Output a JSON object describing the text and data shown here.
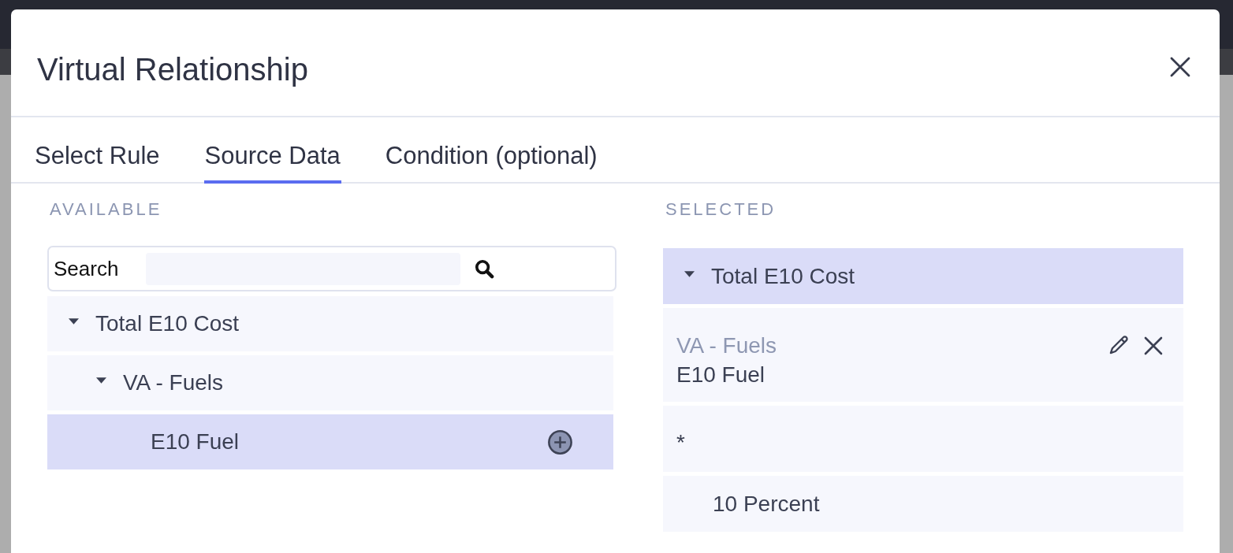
{
  "dialog": {
    "title": "Virtual Relationship"
  },
  "tabs": [
    {
      "label": "Select Rule",
      "selected": false
    },
    {
      "label": "Source Data",
      "selected": true
    },
    {
      "label": "Condition (optional)",
      "selected": false
    }
  ],
  "available": {
    "heading": "AVAILABLE",
    "search": {
      "label": "Search"
    },
    "tree": [
      {
        "label": "Total E10 Cost",
        "expanded": true,
        "selected": false,
        "children": [
          {
            "label": "VA - Fuels",
            "expanded": true,
            "selected": false,
            "children": [
              {
                "label": "E10 Fuel",
                "selected": true
              }
            ]
          }
        ]
      }
    ]
  },
  "selected": {
    "heading": "SELECTED",
    "groups": [
      {
        "label": "Total E10 Cost",
        "expanded": true,
        "selected": true,
        "items": [
          {
            "kind": "field",
            "source": "VA - Fuels",
            "label": "E10 Fuel"
          },
          {
            "kind": "operator",
            "label": "*"
          },
          {
            "kind": "constant",
            "label": "10 Percent"
          }
        ]
      }
    ]
  }
}
